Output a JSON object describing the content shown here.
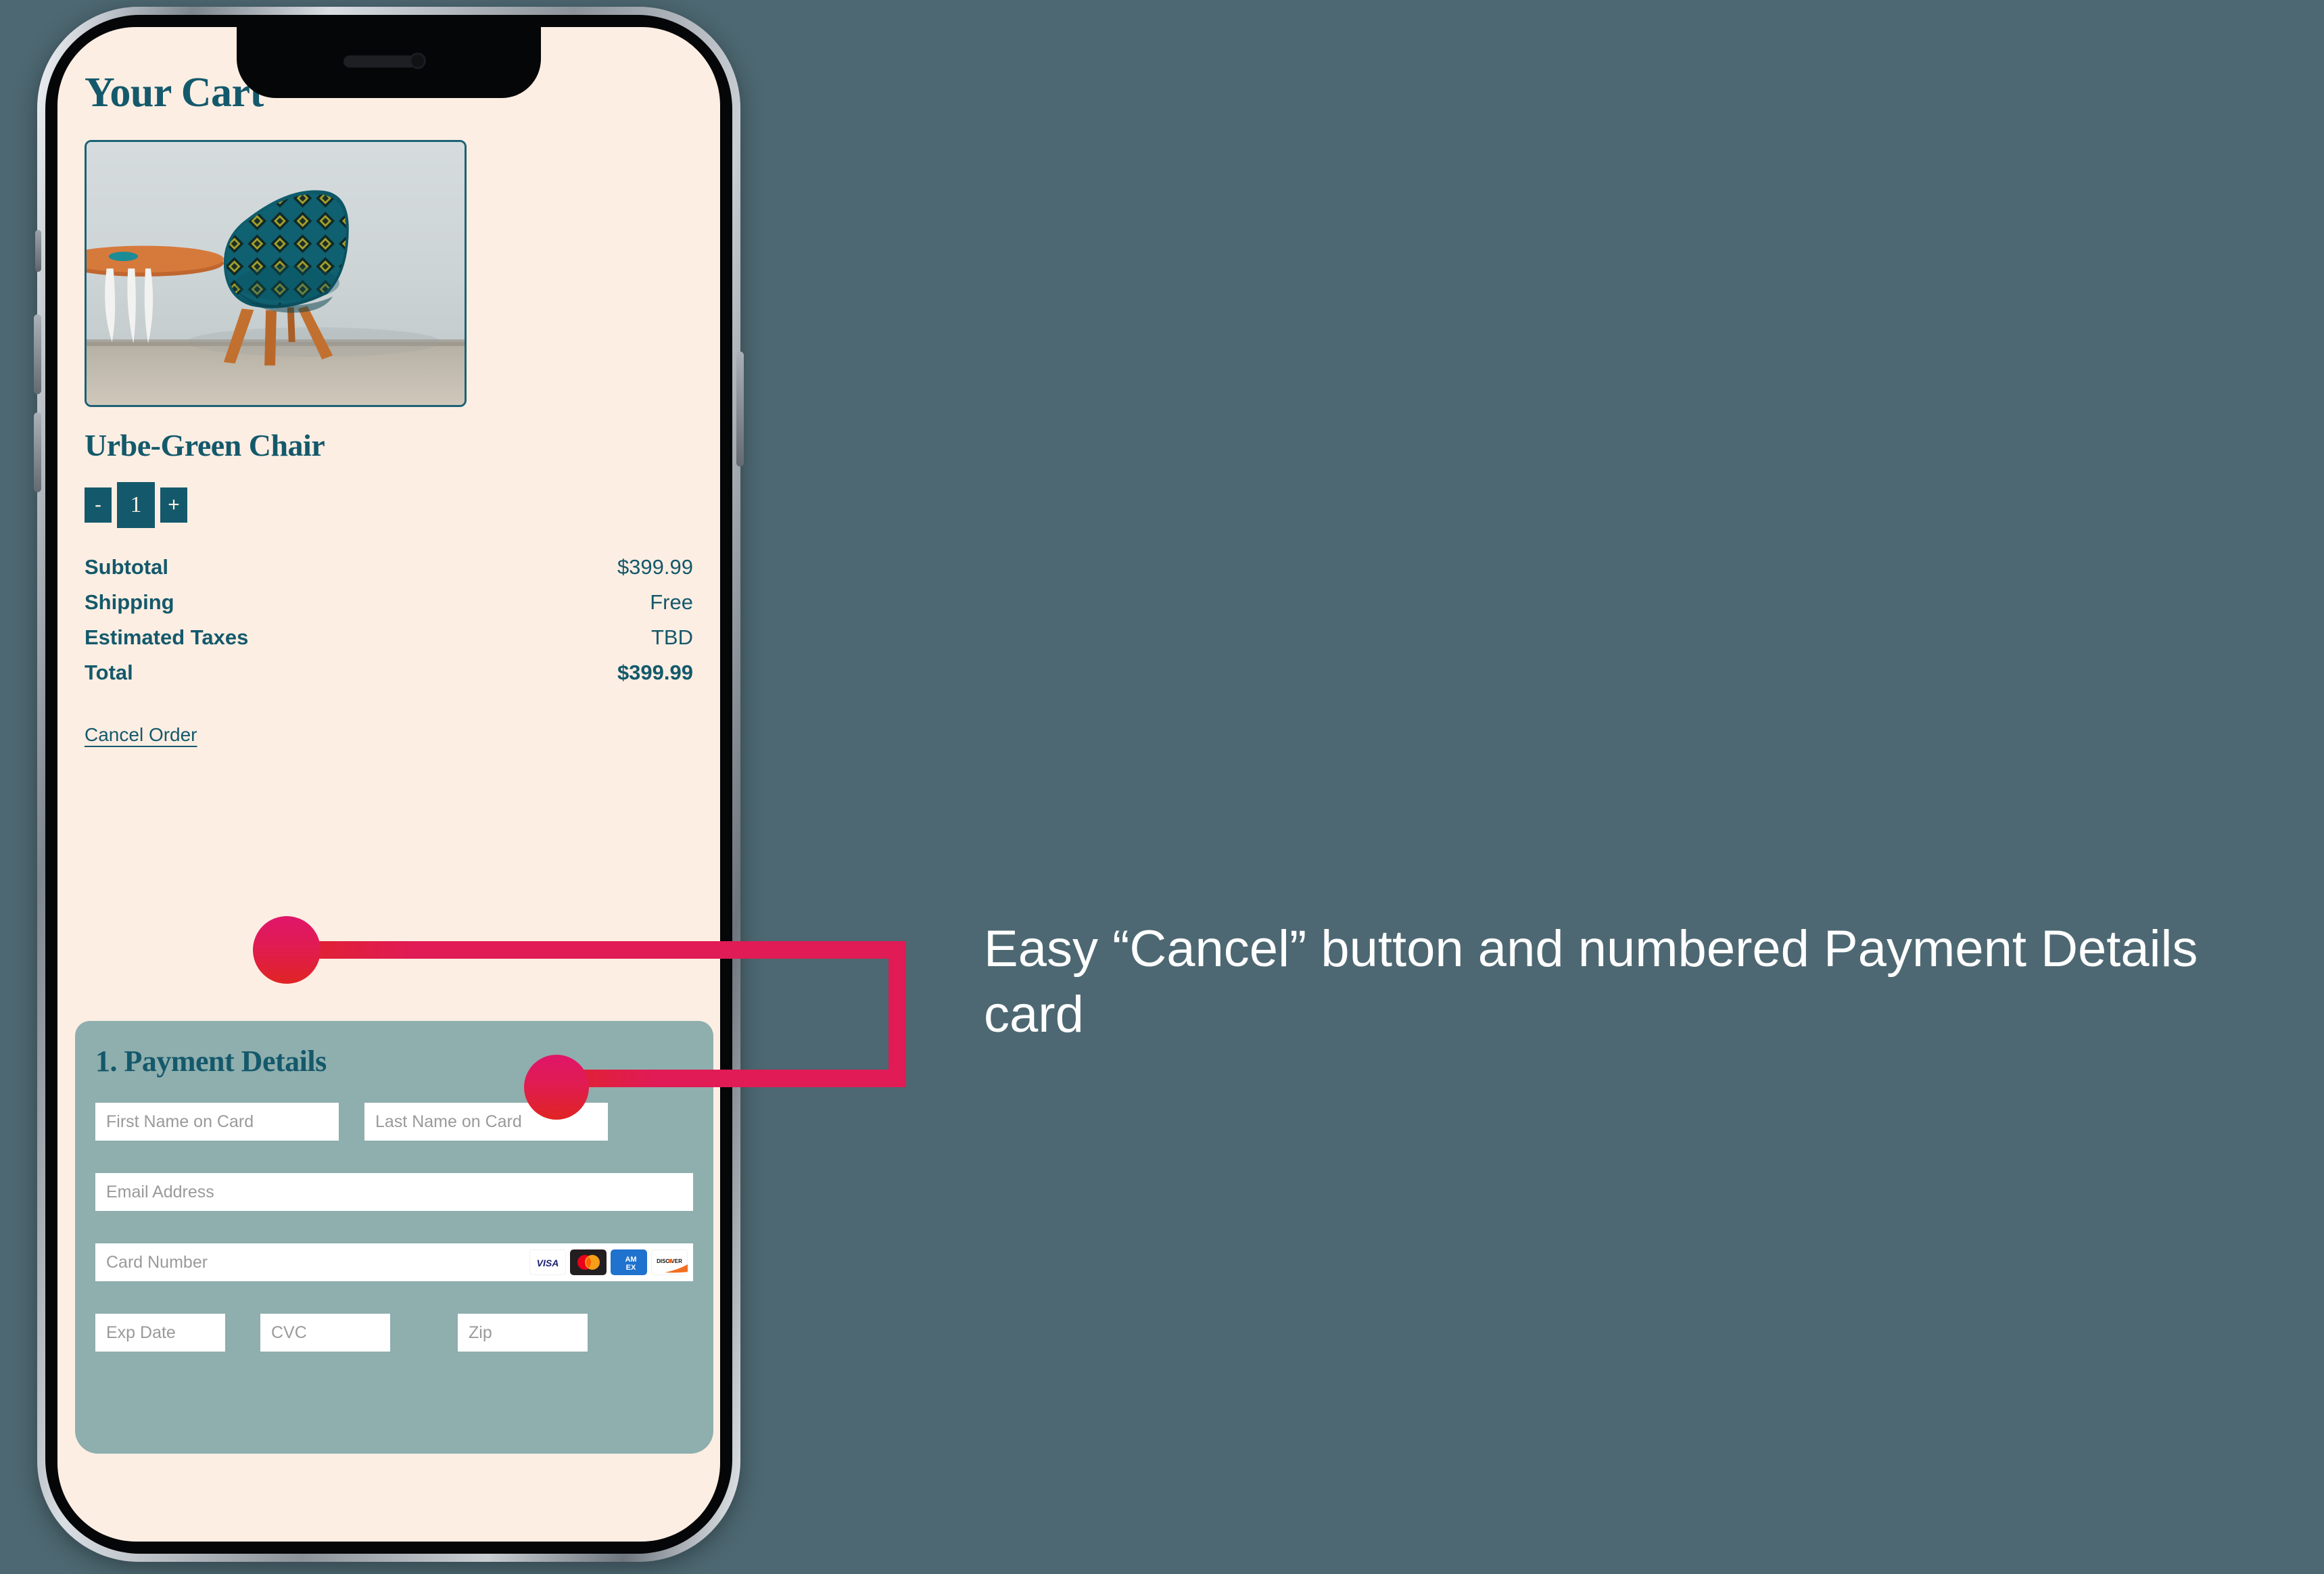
{
  "page": {
    "background_color": "#4d6872",
    "screen_background": "#fdeee3",
    "accent_teal": "#14596b",
    "card_background": "#8faeae",
    "annotation_color": "#e01b55"
  },
  "cart": {
    "title": "Your Cart",
    "product": {
      "name": "Urbe-Green Chair",
      "image_alt": "Teal patterned accent chair beside a wooden side table"
    },
    "quantity": {
      "decrement_label": "-",
      "value": "1",
      "increment_label": "+"
    },
    "totals": [
      {
        "label": "Subtotal",
        "value": "$399.99"
      },
      {
        "label": "Shipping",
        "value": "Free"
      },
      {
        "label": "Estimated Taxes",
        "value": "TBD"
      },
      {
        "label": "Total",
        "value": "$399.99"
      }
    ],
    "cancel_link": "Cancel Order"
  },
  "payment": {
    "heading": "1. Payment Details",
    "fields": {
      "first_name": "First Name on Card",
      "last_name": "Last Name on Card",
      "email": "Email Address",
      "card_number": "Card Number",
      "exp_date": "Exp Date",
      "cvc": "CVC",
      "zip": "Zip"
    },
    "accepted_cards": [
      "VISA",
      "Mastercard",
      "AMEX",
      "DISCOVER"
    ]
  },
  "annotation": {
    "text": "Easy “Cancel” button and numbered Payment Details card"
  }
}
